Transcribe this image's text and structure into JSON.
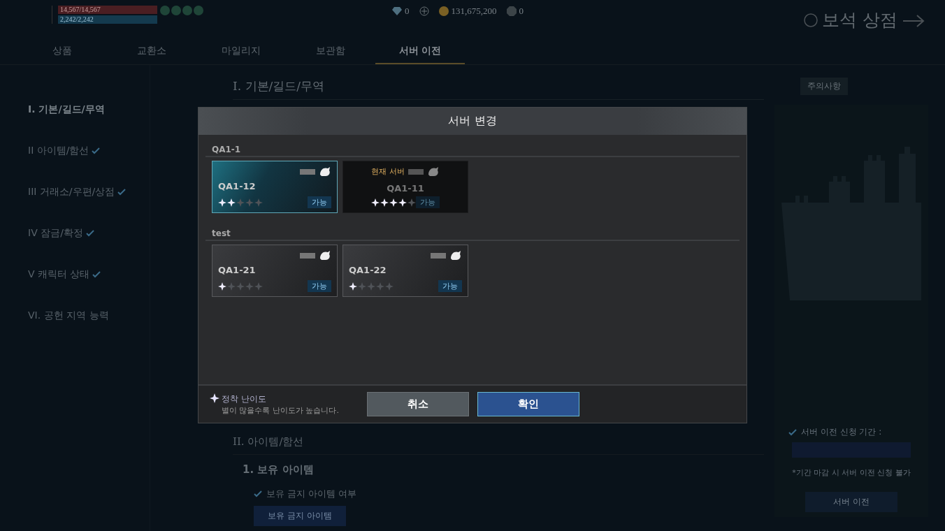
{
  "status": {
    "hp": "14,567/14,567",
    "mp": "2,242/2,242"
  },
  "currencies": [
    {
      "kind": "gem",
      "amount": "0"
    },
    {
      "kind": "add"
    },
    {
      "kind": "gold",
      "amount": "131,675,200"
    },
    {
      "kind": "mileage",
      "amount": "0"
    }
  ],
  "shop_title": "보석 상점",
  "tabs": [
    {
      "label": "상품",
      "selected": false
    },
    {
      "label": "교환소",
      "selected": false
    },
    {
      "label": "마일리지",
      "selected": false
    },
    {
      "label": "보관함",
      "selected": false
    },
    {
      "label": "서버 이전",
      "selected": true
    }
  ],
  "sidebar": [
    {
      "numeral": "I.",
      "label": "기본/길드/무역",
      "checked": false,
      "selected": true
    },
    {
      "numeral": "II",
      "label": "아이템/함선",
      "checked": true,
      "selected": false
    },
    {
      "numeral": "III",
      "label": "거래소/우편/상점",
      "checked": true,
      "selected": false
    },
    {
      "numeral": "IV",
      "label": "잠금/확정",
      "checked": true,
      "selected": false
    },
    {
      "numeral": "V",
      "label": "캐릭터 상태",
      "checked": true,
      "selected": false
    },
    {
      "numeral": "VI.",
      "label": "공헌 지역 능력",
      "checked": false,
      "selected": false
    }
  ],
  "content": {
    "heading": "I. 기본/길드/무역",
    "notice_button": "주의사항",
    "section2": "II. 아이템/함선",
    "subsection": "1. 보유 아이템",
    "check_label": "보유 금지 아이템 여부",
    "item_button": "보유 금지 아이템"
  },
  "side_panel": {
    "period_label": "서버 이전 신청 기간 :",
    "note": "*기간 마감 시 서버 이전 신청 불가",
    "button": "서버 이전"
  },
  "dialog": {
    "title": "서버 변경",
    "groups": [
      {
        "name": "QA1-1",
        "servers": [
          {
            "name": "QA1-12",
            "current": false,
            "selected": true,
            "stars": 2,
            "status": "가능"
          },
          {
            "name": "QA1-11",
            "current": true,
            "selected": false,
            "stars": 4,
            "status": "가능",
            "current_label": "현재 서버"
          }
        ]
      },
      {
        "name": "test",
        "servers": [
          {
            "name": "QA1-21",
            "current": false,
            "selected": false,
            "stars": 1,
            "status": "가능"
          },
          {
            "name": "QA1-22",
            "current": false,
            "selected": false,
            "stars": 1,
            "status": "가능"
          }
        ]
      }
    ],
    "legend_title": "정착 난이도",
    "legend_text": "별이 많을수록 난이도가 높습니다.",
    "buttons": [
      {
        "kind": "cancel",
        "label": "취소"
      },
      {
        "kind": "confirm",
        "label": "확인"
      }
    ]
  }
}
